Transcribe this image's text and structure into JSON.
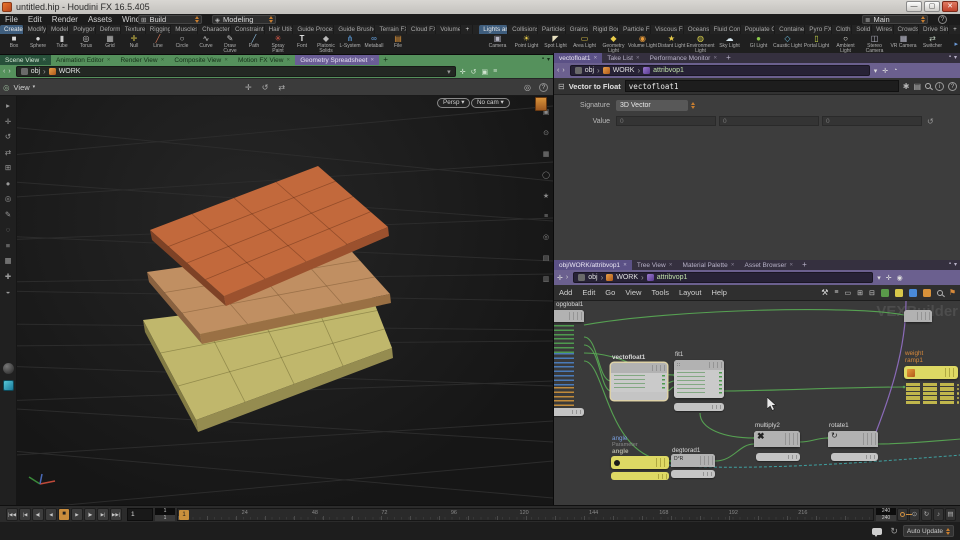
{
  "titlebar": {
    "title": "untitled.hip - Houdini FX 16.5.405",
    "minimize": "—",
    "maximize": "▢",
    "close": "✕"
  },
  "menubar": {
    "items": [
      "File",
      "Edit",
      "Render",
      "Assets",
      "Windows",
      "Help"
    ],
    "build_label": "Build",
    "modeling_label": "Modeling",
    "desktop_label": "Main",
    "help_label": "?"
  },
  "shelf": {
    "left_tabs": [
      "Create",
      "Modify",
      "Model",
      "Polygon",
      "Deform",
      "Texture",
      "Rigging",
      "Muscles",
      "Characters",
      "Constraints",
      "Hair Utils",
      "Guide Process",
      "Guide Brushes",
      "Terrain FX",
      "Cloud FX",
      "Volume"
    ],
    "right_tabs": [
      "Lights an",
      "Collisions",
      "Particles",
      "Grains",
      "Rigid Bod",
      "Particle Fl.",
      "Viscous Fl.",
      "Oceans",
      "Fluid Con.",
      "Populate C.",
      "Container",
      "Pyro FX",
      "Cloth",
      "Solid",
      "Wires",
      "Crowds",
      "Drive Sim"
    ],
    "add_tab": "+",
    "left_tools": [
      {
        "label": "Box",
        "glyph": "■"
      },
      {
        "label": "Sphere",
        "glyph": "●"
      },
      {
        "label": "Tube",
        "glyph": "▮"
      },
      {
        "label": "Torus",
        "glyph": "◎"
      },
      {
        "label": "Grid",
        "glyph": "▦"
      },
      {
        "label": "Null",
        "glyph": "✛"
      },
      {
        "label": "Line",
        "glyph": "╱"
      },
      {
        "label": "Circle",
        "glyph": "○"
      },
      {
        "label": "Curve",
        "glyph": "∿"
      },
      {
        "label": "Draw Curve",
        "glyph": "✎"
      },
      {
        "label": "Path",
        "glyph": "╱"
      },
      {
        "label": "Spray Paint",
        "glyph": "✳"
      },
      {
        "label": "Font",
        "glyph": "T"
      },
      {
        "label": "Platonic Solids",
        "glyph": "◆"
      },
      {
        "label": "L-System",
        "glyph": "⋔"
      },
      {
        "label": "Metaball",
        "glyph": "∞"
      },
      {
        "label": "File",
        "glyph": "▤"
      }
    ],
    "right_tools": [
      {
        "label": "Camera",
        "glyph": "▣"
      },
      {
        "label": "Point Light",
        "glyph": "☀"
      },
      {
        "label": "Spot Light",
        "glyph": "◤"
      },
      {
        "label": "Area Light",
        "glyph": "▭"
      },
      {
        "label": "Geometry Light",
        "glyph": "◆"
      },
      {
        "label": "Volume Light",
        "glyph": "◉"
      },
      {
        "label": "Distant Light",
        "glyph": "★"
      },
      {
        "label": "Environment Light",
        "glyph": "◍"
      },
      {
        "label": "Sky Light",
        "glyph": "☁"
      },
      {
        "label": "GI Light",
        "glyph": "●"
      },
      {
        "label": "Caustic Light",
        "glyph": "◇"
      },
      {
        "label": "Portal Light",
        "glyph": "▯"
      },
      {
        "label": "Ambient Light",
        "glyph": "○"
      },
      {
        "label": "Stereo Camera",
        "glyph": "◫"
      },
      {
        "label": "VR Camera",
        "glyph": "▦"
      },
      {
        "label": "Switcher",
        "glyph": "⇄"
      }
    ]
  },
  "scene_pane": {
    "tabs": [
      "Scene View",
      "Animation Editor",
      "Render View",
      "Composite View",
      "Motion FX View",
      "Geometry Spreadsheet"
    ],
    "close_glyph": "✕",
    "add_tab": "+",
    "path_root": "obj",
    "path_node": "WORK",
    "view_label": "View",
    "persp_label": "Persp",
    "nocam_label": "No cam",
    "caret": "▾",
    "center_icons": [
      "✛",
      "↺",
      "⇄"
    ],
    "left_icons": [
      "▸",
      "✛",
      "↺",
      "⇄",
      "⊞",
      "●",
      "◎",
      "✎",
      "◌",
      "≡",
      "▦",
      "✚",
      "◒"
    ],
    "right_icons": [
      "▣",
      "⊙",
      "▦",
      "◯",
      "★",
      "≡",
      "◎",
      "▤",
      "▥"
    ]
  },
  "param_pane": {
    "tabs": [
      "vectofloat1",
      "Take List",
      "Performance Monitor"
    ],
    "path": [
      "obj",
      "WORK",
      "attribvop1"
    ],
    "type_label": "Vector to Float",
    "name_value": "vectofloat1",
    "signature_label": "Signature",
    "signature_value": "3D Vector",
    "value_label": "Value",
    "values": [
      "0",
      "0",
      "0"
    ]
  },
  "network_pane": {
    "tabs": [
      "obj/WORK/attribvop1",
      "Tree View",
      "Material Palette",
      "Asset Browser"
    ],
    "path": [
      "obj",
      "WORK",
      "attribvop1"
    ],
    "menus": [
      "Add",
      "Edit",
      "Go",
      "View",
      "Tools",
      "Layout",
      "Help"
    ],
    "watermark": "VEXBuilder",
    "nodes": {
      "global_name": "opglobal1",
      "vectofloat_name": "vectofloat1",
      "fit_name": "fit1",
      "multiply_name": "multiply2",
      "multiply_op": "✖",
      "rotate_name": "rotate1",
      "rotate_glyph": "↻",
      "angle_channel": "angle",
      "angle_type": "Parameter",
      "angle_name": "angle",
      "degtorad_name": "degtorad1",
      "ramp_channel": "weight",
      "ramp_name": "ramp1"
    }
  },
  "playbar": {
    "transport": [
      "|◀◀",
      "|◀",
      "◀|",
      "◀",
      "■",
      "▶",
      "|▶",
      "▶|",
      "▶▶|"
    ],
    "current": "1",
    "range_start_top": "1",
    "range_start_bottom": "1",
    "range_end_top": "240",
    "range_end_bottom": "240",
    "ticks": [
      "24",
      "48",
      "72",
      "96",
      "120",
      "144",
      "168",
      "192",
      "216"
    ],
    "playhead": "1",
    "extra_buttons": [
      "⊙",
      "↻",
      "♪",
      "▤"
    ],
    "auto_update_label": "Auto Update"
  },
  "colors": {
    "accent_orange": "#c98c3c",
    "node_yellow": "#ded964",
    "wire_green": "#56a152",
    "wire_purple": "#8a6ab8",
    "wire_teal": "#3f9f9f",
    "tab_green": "#55915c",
    "tab_purple": "#5b5186",
    "select_blue": "#3f5e7e",
    "surface_orange": "#c2693c",
    "surface_tan": "#c08f62",
    "surface_yellow": "#c0b76c"
  }
}
